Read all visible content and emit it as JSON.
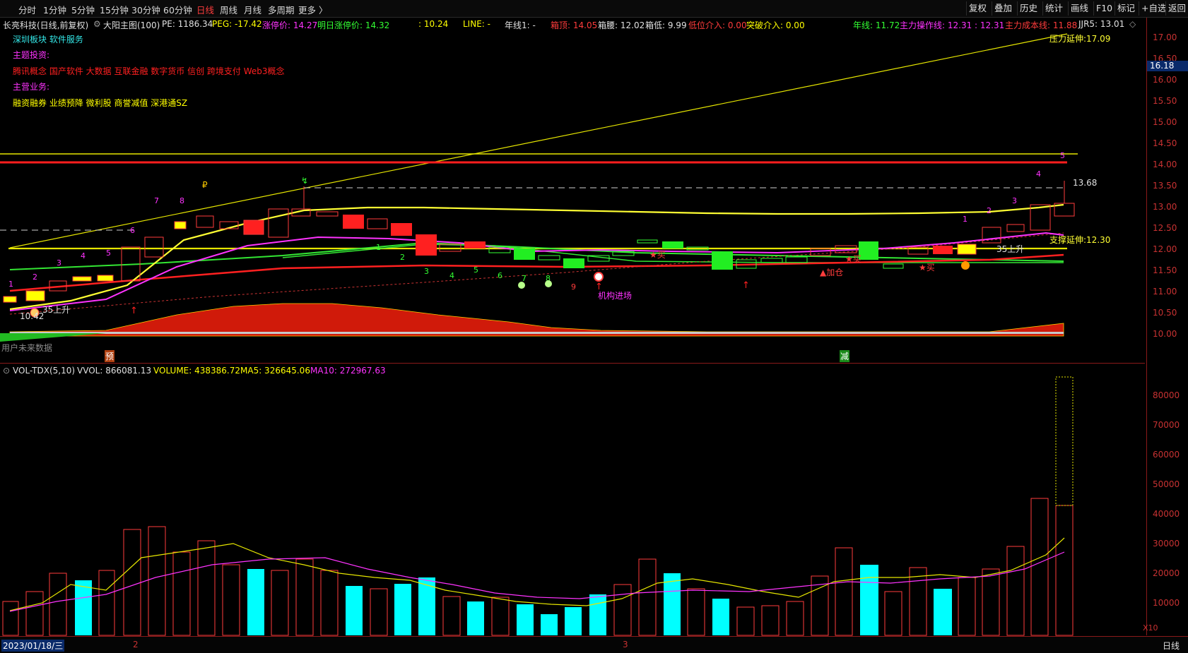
{
  "toolbar": {
    "periods": [
      "分时",
      "1分钟",
      "5分钟",
      "15分钟",
      "30分钟",
      "60分钟",
      "日线",
      "周线",
      "月线",
      "多周期",
      "更多 〉"
    ],
    "active_period": "日线",
    "right_buttons": [
      "复权",
      "叠加",
      "历史",
      "统计",
      "画线",
      "F10",
      "标记",
      "+自选",
      "返回"
    ]
  },
  "info": {
    "stock": "长亮科技(日线,前复权)",
    "main_chart": "大阳主图(100)",
    "pe": "PE: 1186.34",
    "peg": "PEG: -17.42",
    "limit_up": "涨停价: 14.27",
    "next_limit_up": "明日涨停价: 14.32",
    "v1": ": 10.24",
    "line": "LINE: -",
    "yearline1": "年线1: -",
    "box_top": "箱顶: 14.05",
    "box_mid": "箱腰: 12.02",
    "box_low": "箱低: 9.99",
    "low_entry": "低位介入: 0.00",
    "break_entry": "突破介入: 0.00",
    "yearline": "年线: 11.72",
    "main_op_line": "主力操作线: 12.31 : 12.31",
    "main_cost": "主力成本线: 11.88",
    "jjr5": "JJR5: 13.01"
  },
  "left_panel": {
    "sector": "深圳板块  软件服务",
    "theme_title": "主题投资:",
    "theme_items": "腾讯概念 国产软件 大数据 互联金融 数字货币 信创 跨境支付 Web3概念",
    "business_title": "主营业务:",
    "business_items": "融资融券 业绩预降 微利股 商誉减值 深港通SZ"
  },
  "annotations": {
    "pressure_ext": "压力延伸:17.09",
    "support_ext": "支撑延伸:12.30",
    "high_mark": "13.68",
    "low_mark": "10.42",
    "inst_entry": "机构进场",
    "add_pos": "▲加仓",
    "buy1": "★买",
    "buy2": "★买",
    "buy3": "★买",
    "up_label1": "35上升",
    "up_label2": "35上升",
    "future_label": "用户未来数据",
    "pre_tag": "预",
    "minus_tag": "减",
    "current_price": "16.18"
  },
  "price_axis": [
    "17.00",
    "16.50",
    "16.00",
    "15.50",
    "15.00",
    "14.50",
    "14.00",
    "13.50",
    "13.00",
    "12.50",
    "12.00",
    "11.50",
    "11.00",
    "10.50",
    "10.00"
  ],
  "volume_panel": {
    "title": "VOL-TDX(5,10)",
    "vvol": "VVOL: 866081.13",
    "volume": "VOLUME: 438386.72",
    "ma5": "MA5: 326645.06",
    "ma10": "MA10: 272967.63",
    "axis": [
      "80000",
      "70000",
      "60000",
      "50000",
      "40000",
      "30000",
      "20000",
      "10000"
    ],
    "unit": "X10"
  },
  "bottom": {
    "date": "2023/01/18/三",
    "month2": "2",
    "month3": "3",
    "period": "日线"
  },
  "colors": {
    "up": "#ff3c3c",
    "down_vol": "#00ffff",
    "yellow": "#ffff00",
    "magenta": "#ff33ff",
    "green": "#33ff33"
  }
}
